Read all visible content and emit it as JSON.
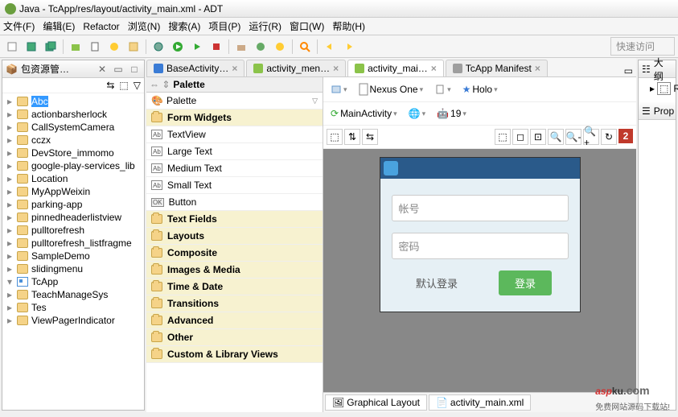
{
  "title": "Java - TcApp/res/layout/activity_main.xml - ADT",
  "menu": [
    "文件(F)",
    "编辑(E)",
    "Refactor",
    "浏览(N)",
    "搜索(A)",
    "项目(P)",
    "运行(R)",
    "窗口(W)",
    "帮助(H)"
  ],
  "quick_access_placeholder": "快速访问",
  "pkg_explorer": {
    "title": "包资源管…",
    "items": [
      {
        "label": "Abc",
        "selected": true
      },
      {
        "label": "actionbarsherlock"
      },
      {
        "label": "CallSystemCamera"
      },
      {
        "label": "cczx"
      },
      {
        "label": "DevStore_immomo"
      },
      {
        "label": "google-play-services_lib"
      },
      {
        "label": "Location"
      },
      {
        "label": "MyAppWeixin"
      },
      {
        "label": "parking-app"
      },
      {
        "label": "pinnedheaderlistview"
      },
      {
        "label": "pulltorefresh"
      },
      {
        "label": "pulltorefresh_listfragme"
      },
      {
        "label": "SampleDemo"
      },
      {
        "label": "slidingmenu"
      },
      {
        "label": "TcApp",
        "expanded": true,
        "special": true
      },
      {
        "label": "TeachManageSys"
      },
      {
        "label": "Tes"
      },
      {
        "label": "ViewPagerIndicator"
      }
    ]
  },
  "editor_tabs": [
    {
      "label": "BaseActivity…",
      "type": "j"
    },
    {
      "label": "activity_men…",
      "type": "a"
    },
    {
      "label": "activity_mai…",
      "type": "a",
      "active": true
    },
    {
      "label": "TcApp Manifest",
      "type": "m"
    }
  ],
  "palette": {
    "title": "Palette",
    "current": "Palette",
    "items": [
      {
        "label": "Form Widgets",
        "cat": true
      },
      {
        "label": "TextView",
        "icon": "Ab"
      },
      {
        "label": "Large Text",
        "icon": "Ab"
      },
      {
        "label": "Medium Text",
        "icon": "Ab"
      },
      {
        "label": "Small Text",
        "icon": "Ab"
      },
      {
        "label": "Button",
        "icon": "OK"
      },
      {
        "label": "Text Fields",
        "cat": true
      },
      {
        "label": "Layouts",
        "cat": true
      },
      {
        "label": "Composite",
        "cat": true
      },
      {
        "label": "Images & Media",
        "cat": true
      },
      {
        "label": "Time & Date",
        "cat": true
      },
      {
        "label": "Transitions",
        "cat": true
      },
      {
        "label": "Advanced",
        "cat": true
      },
      {
        "label": "Other",
        "cat": true
      },
      {
        "label": "Custom & Library Views",
        "cat": true
      }
    ]
  },
  "layout_toolbar": {
    "device": "Nexus One",
    "theme": "Holo",
    "activity": "MainActivity",
    "api": "19",
    "error_count": "2"
  },
  "phone": {
    "field1": "帐号",
    "field2": "密码",
    "default_login": "默认登录",
    "login": "登录"
  },
  "bottom_tabs": [
    "Graphical Layout",
    "activity_main.xml"
  ],
  "outline": {
    "title": "大纲",
    "root": "R",
    "props": "Prop"
  },
  "watermark": {
    "brand_a": "asp",
    "brand_b": "ku",
    "tld": ".com",
    "sub": "免费网站源码下载站!"
  }
}
